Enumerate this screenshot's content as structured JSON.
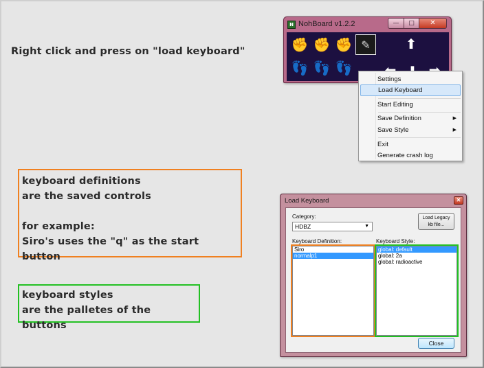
{
  "instruction": "Right click and press on \"load keyboard\"",
  "definitions_note": {
    "line1": "keyboard definitions",
    "line2": "are the saved controls",
    "line3": "for example:",
    "line4": "Siro's uses the \"q\" as the start button"
  },
  "styles_note": {
    "line1": "keyboard styles",
    "line2": "are the palletes of the buttons"
  },
  "nohboard_window": {
    "title": "NohBoard v1.2.2",
    "keys": [
      {
        "icon": "blue-fist-icon",
        "glyph": "✊",
        "color": "#1e88e5"
      },
      {
        "icon": "yellow-fist-icon",
        "glyph": "✊",
        "color": "#f4c20d"
      },
      {
        "icon": "red-fist-icon",
        "glyph": "✊",
        "color": "#e53935"
      },
      {
        "icon": "gear-pen-icon",
        "glyph": "✎",
        "color": "#d8d8d8"
      },
      {
        "icon": "arrow-up-icon",
        "glyph": "⬆",
        "color": "#ffffff"
      },
      {
        "icon": "blue-foot-icon",
        "glyph": "👣",
        "color": "#1e88e5"
      },
      {
        "icon": "yellow-foot-icon",
        "glyph": "👣",
        "color": "#f4c20d"
      },
      {
        "icon": "red-foot-icon",
        "glyph": "👣",
        "color": "#e53935"
      },
      {
        "icon": "arrow-left-icon",
        "glyph": "⬅",
        "color": "#ffffff"
      },
      {
        "icon": "arrow-down-icon",
        "glyph": "⬇",
        "color": "#ffffff"
      },
      {
        "icon": "arrow-right-icon",
        "glyph": "➡",
        "color": "#ffffff"
      }
    ]
  },
  "context_menu": {
    "settings": "Settings",
    "load_keyboard": "Load Keyboard",
    "start_editing": "Start Editing",
    "save_definition": "Save Definition",
    "save_style": "Save Style",
    "exit": "Exit",
    "generate_crash_log": "Generate crash log"
  },
  "load_keyboard_dialog": {
    "title": "Load Keyboard",
    "category_label": "Category:",
    "category_value": "HDBZ",
    "legacy_button_line1": "Load Legacy",
    "legacy_button_line2": "kb file...",
    "definition_label": "Keyboard Definition:",
    "style_label": "Keyboard Style:",
    "definitions": [
      "Siro",
      "normalp1"
    ],
    "styles": [
      "global: default",
      "global: 2a",
      "global: radioactive"
    ],
    "close_button": "Close"
  },
  "colors": {
    "definition_highlight": "#f08020",
    "style_highlight": "#22c022",
    "selection": "#3399ff"
  }
}
